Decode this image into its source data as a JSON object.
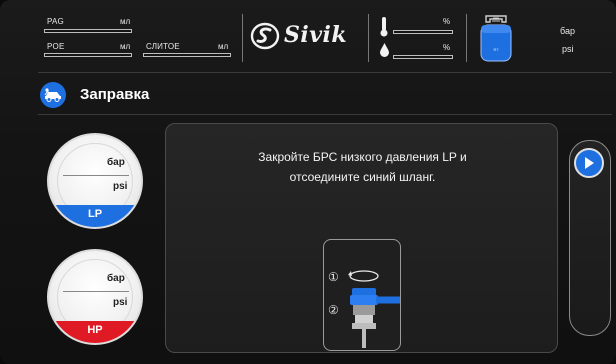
{
  "header": {
    "fluids": [
      {
        "label": "PAG",
        "unit": "мл"
      },
      {
        "label": "POE",
        "unit": "мл"
      },
      {
        "label": "СЛИТОЕ",
        "unit": "мл"
      }
    ],
    "logo_text": "Sivik",
    "level_percent_unit": "%",
    "weight_percent_unit": "%",
    "tank": {
      "label": "R",
      "pressure_unit_bar": "бар",
      "pressure_unit_psi": "psi"
    }
  },
  "page": {
    "title": "Заправка"
  },
  "gauges": {
    "lp": {
      "unit_bar": "бар",
      "unit_psi": "psi",
      "label": "LP",
      "color": "#1e6fe0"
    },
    "hp": {
      "unit_bar": "бар",
      "unit_psi": "psi",
      "label": "HP",
      "color": "#e01a24"
    }
  },
  "instruction": {
    "line1": "Закройте БРС низкого давления LP и",
    "line2": "отсоедините синий шланг.",
    "step1": "①",
    "step2": "②"
  },
  "colors": {
    "accent": "#1e6fe0",
    "hp_red": "#e01a24",
    "background": "#141414"
  },
  "icons": {
    "title": "car-service-icon",
    "next": "play-arrow-icon",
    "logo": "sivik-logo-icon",
    "thermometer": "thermometer-icon",
    "drop": "oil-drop-icon",
    "tank": "refrigerant-tank-icon"
  }
}
